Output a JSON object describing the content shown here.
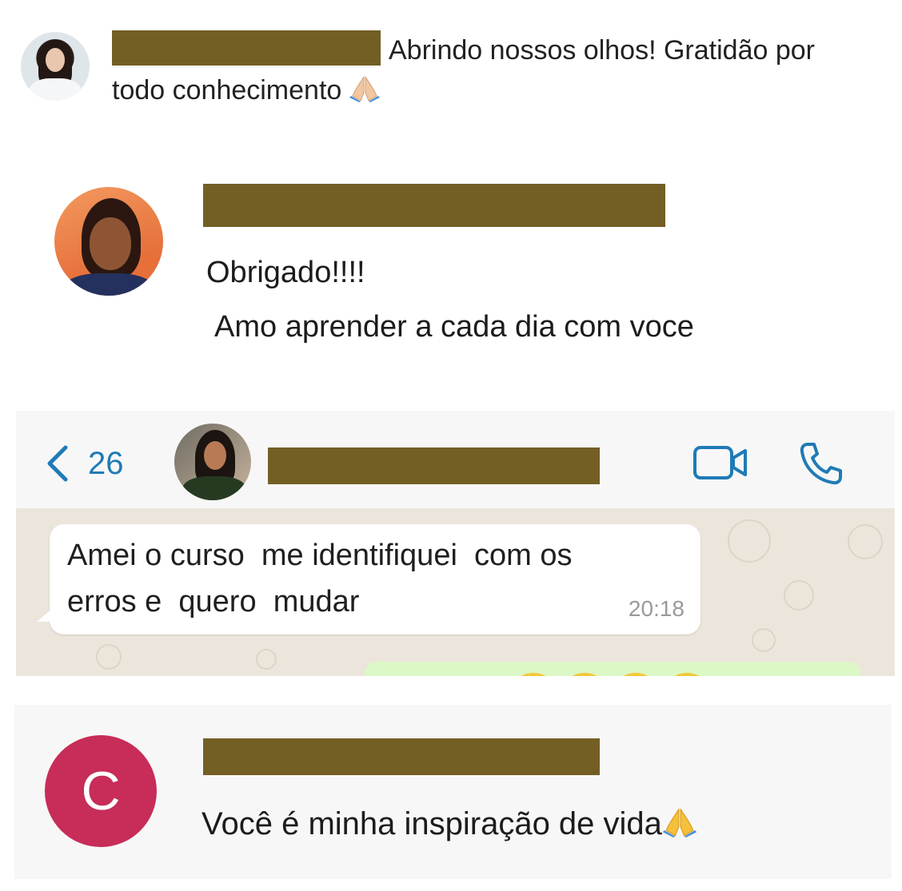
{
  "comment_1": {
    "text_part1": "Abrindo nossos olhos! Gratidão por",
    "text_part2": "todo conhecimento",
    "emoji": "pray-icon"
  },
  "comment_2": {
    "line1": "Obrigado!!!!",
    "line2": "Amo aprender a cada dia com voce"
  },
  "whatsapp": {
    "back_count": "26",
    "message": "Amei o curso  me identifiquei  com os\nerros e  quero  mudar",
    "time": "20:18",
    "accent_color": "#1e7bb6"
  },
  "comment_4": {
    "avatar_letter": "C",
    "avatar_color": "#c72d58",
    "text": "Você é minha inspiração de vida",
    "emoji": "pray-icon"
  },
  "redaction_color": "#735f23"
}
